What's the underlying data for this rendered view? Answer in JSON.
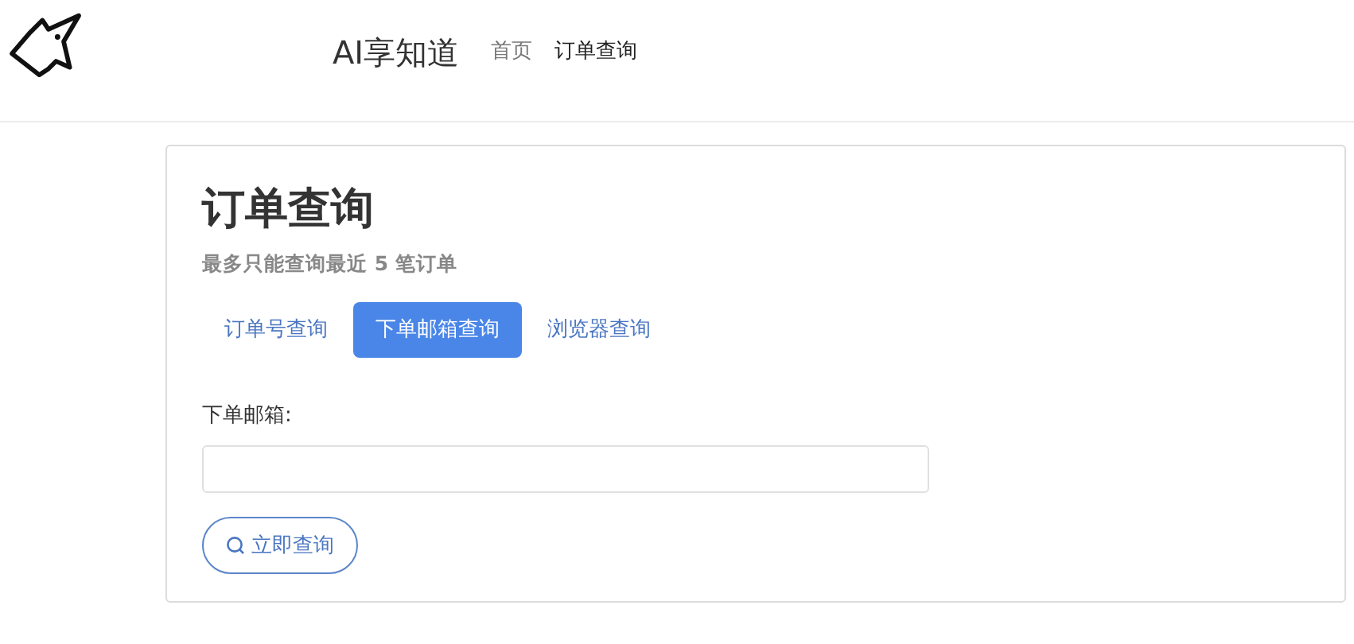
{
  "header": {
    "brand": "AI享知道",
    "nav": [
      {
        "label": "首页",
        "selected": false
      },
      {
        "label": "订单查询",
        "selected": true
      }
    ]
  },
  "card": {
    "title": "订单查询",
    "subtitle": "最多只能查询最近 5 笔订单",
    "tabs": [
      {
        "label": "订单号查询",
        "selected": false
      },
      {
        "label": "下单邮箱查询",
        "selected": true
      },
      {
        "label": "浏览器查询",
        "selected": false
      }
    ],
    "field": {
      "label": "下单邮箱:"
    },
    "button": "立即查询"
  }
}
